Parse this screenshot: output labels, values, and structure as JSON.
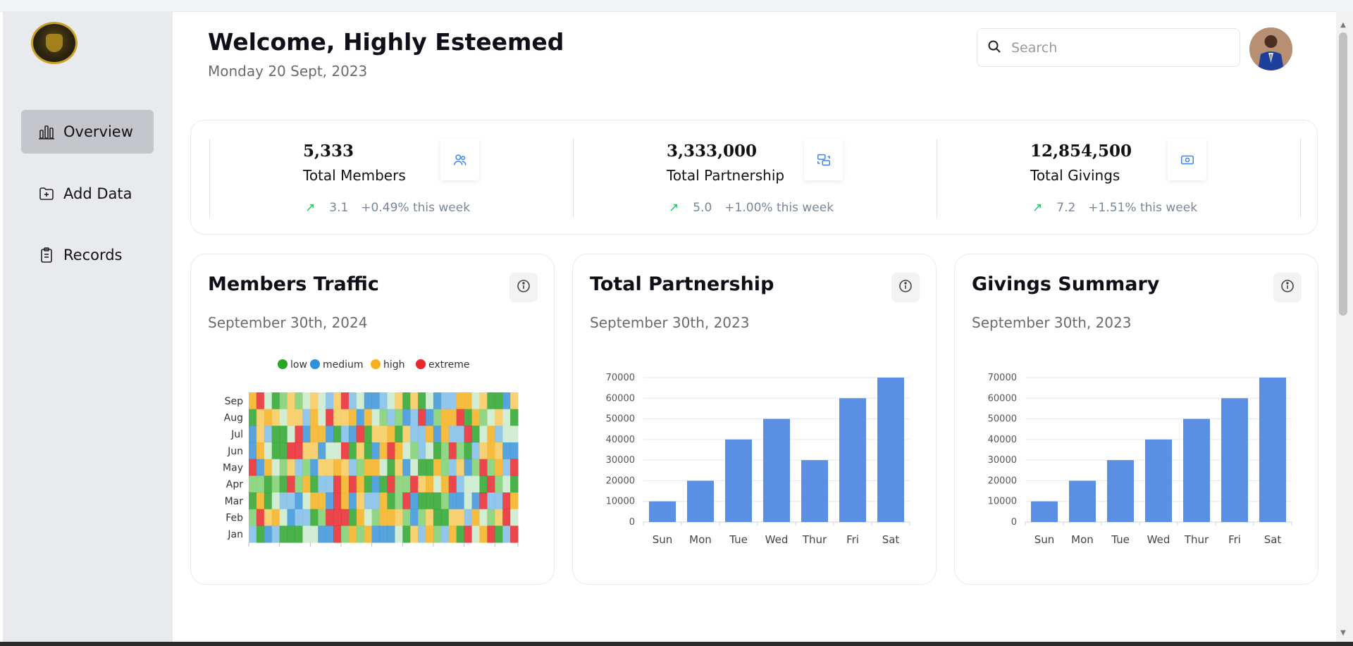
{
  "header": {
    "title": "Welcome, Highly Esteemed",
    "date": "Monday 20 Sept, 2023",
    "search_placeholder": "Search"
  },
  "sidebar": {
    "items": [
      {
        "label": "Overview",
        "icon": "bar-chart-icon",
        "active": true
      },
      {
        "label": "Add Data",
        "icon": "folder-plus-icon",
        "active": false
      },
      {
        "label": "Records",
        "icon": "clipboard-icon",
        "active": false
      }
    ]
  },
  "stats": [
    {
      "value": "5,333",
      "label": "Total Members",
      "icon": "users-icon",
      "rate": "3.1",
      "change": "+0.49% this week"
    },
    {
      "value": "3,333,000",
      "label": "Total Partnership",
      "icon": "transfer-icon",
      "rate": "5.0",
      "change": "+1.00% this week"
    },
    {
      "value": "12,854,500",
      "label": "Total Givings",
      "icon": "money-icon",
      "rate": "7.2",
      "change": "+1.51% this week"
    }
  ],
  "cards": [
    {
      "title": "Members Traffic",
      "date": "September 30th, 2024"
    },
    {
      "title": "Total Partnership",
      "date": "September 30th, 2023"
    },
    {
      "title": "Givings Summary",
      "date": "September 30th, 2023"
    }
  ],
  "colors": {
    "bar": "#5b8fe3",
    "low": "#22a822",
    "medium": "#2f8fd8",
    "high": "#f5b01f",
    "extreme": "#e8262b",
    "up_arrow": "#22c55e"
  },
  "chart_data": [
    {
      "type": "heatmap",
      "title": "Members Traffic",
      "y_categories": [
        "Jan",
        "Feb",
        "Mar",
        "Apr",
        "May",
        "Jun",
        "Jul",
        "Aug",
        "Sep"
      ],
      "legend": [
        "low",
        "medium",
        "high",
        "extreme"
      ],
      "legend_position": "top-center",
      "columns": 35
    },
    {
      "type": "bar",
      "title": "Total Partnership",
      "categories": [
        "Sun",
        "Mon",
        "Tue",
        "Wed",
        "Thur",
        "Fri",
        "Sat"
      ],
      "values": [
        10000,
        20000,
        40000,
        50000,
        30000,
        60000,
        70000
      ],
      "ylim": [
        0,
        70000
      ],
      "yticks": [
        "0",
        "10000",
        "20000",
        "30000",
        "40000",
        "50000",
        "60000",
        "70000"
      ],
      "grid": true
    },
    {
      "type": "bar",
      "title": "Givings Summary",
      "categories": [
        "Sun",
        "Mon",
        "Tue",
        "Wed",
        "Thur",
        "Fri",
        "Sat"
      ],
      "values": [
        10000,
        20000,
        30000,
        40000,
        50000,
        60000,
        70000
      ],
      "ylim": [
        0,
        70000
      ],
      "yticks": [
        "0",
        "10000",
        "20000",
        "30000",
        "40000",
        "50000",
        "60000",
        "70000"
      ],
      "grid": true
    }
  ]
}
